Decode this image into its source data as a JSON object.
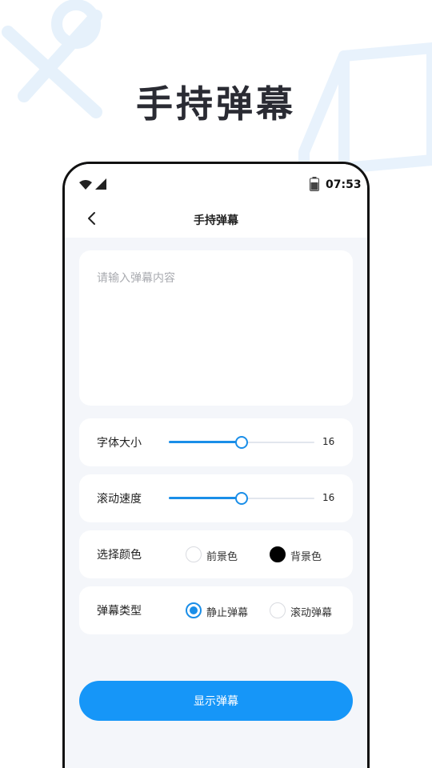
{
  "page": {
    "hero_title": "手持弹幕"
  },
  "status_bar": {
    "time": "07:53"
  },
  "nav": {
    "title": "手持弹幕",
    "back_icon": "chevron-left-icon"
  },
  "text_input": {
    "placeholder": "请输入弹幕内容",
    "value": ""
  },
  "font_size": {
    "label": "字体大小",
    "value": "16",
    "fraction": 0.5
  },
  "scroll_speed": {
    "label": "滚动速度",
    "value": "16",
    "fraction": 0.5
  },
  "color_select": {
    "label": "选择颜色",
    "options": [
      {
        "label": "前景色",
        "swatch": "#ffffff"
      },
      {
        "label": "背景色",
        "swatch": "#000000"
      }
    ]
  },
  "danmaku_type": {
    "label": "弹幕类型",
    "options": [
      {
        "label": "静止弹幕",
        "selected": true
      },
      {
        "label": "滚动弹幕",
        "selected": false
      }
    ]
  },
  "submit": {
    "label": "显示弹幕"
  },
  "colors": {
    "accent": "#1696f8",
    "slider": "#1a8ee8",
    "phone_bg": "#f4f6fa"
  }
}
